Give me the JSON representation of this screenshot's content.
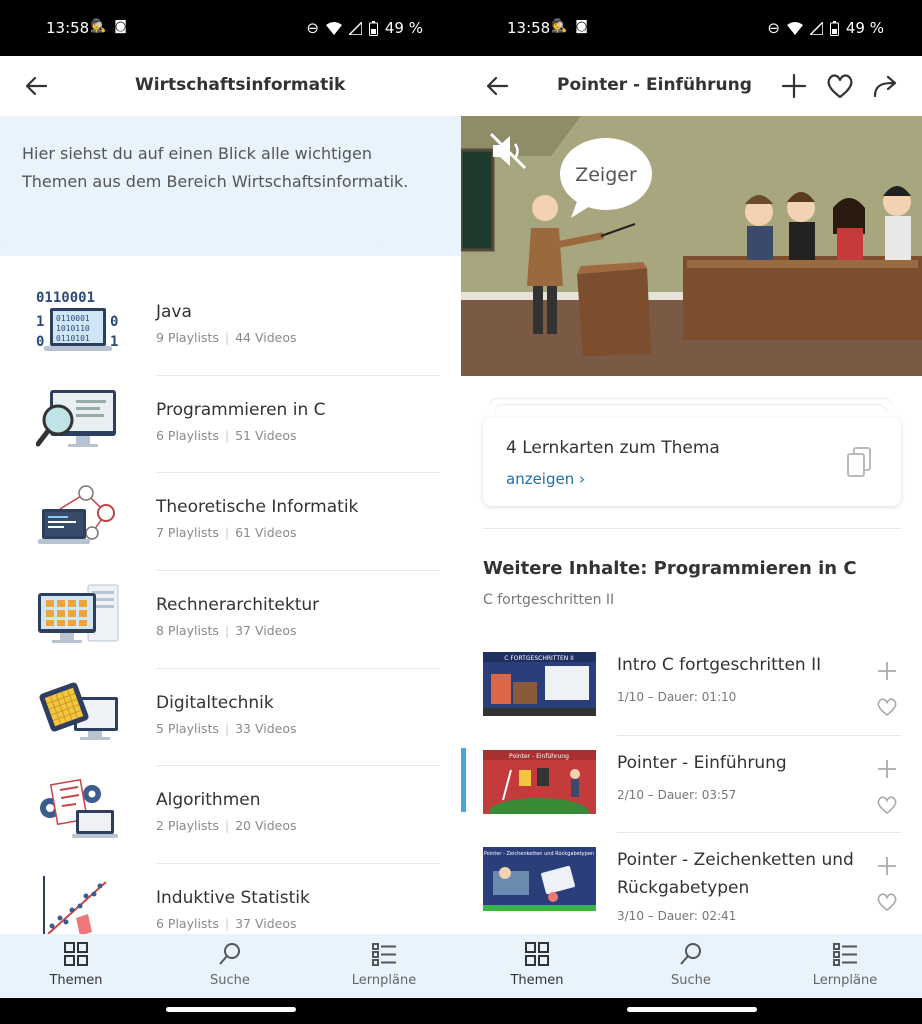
{
  "status": {
    "time": "13:58",
    "battery": "49 %"
  },
  "left": {
    "title": "Wirtschaftsinformatik",
    "intro": "Hier siehst du auf einen Blick alle wichtigen Themen aus dem Bereich Wirtschaftsinformatik.",
    "topics": [
      {
        "name": "Java",
        "playlists": "9 Playlists",
        "videos": "44 Videos",
        "icon": "binary-laptop-icon"
      },
      {
        "name": "Programmieren in C",
        "playlists": "6 Playlists",
        "videos": "51 Videos",
        "icon": "magnifier-monitor-icon"
      },
      {
        "name": "Theoretische Informatik",
        "playlists": "7 Playlists",
        "videos": "61 Videos",
        "icon": "graph-laptop-icon"
      },
      {
        "name": "Rechnerarchitektur",
        "playlists": "8 Playlists",
        "videos": "37 Videos",
        "icon": "computer-tower-icon"
      },
      {
        "name": "Digitaltechnik",
        "playlists": "5 Playlists",
        "videos": "33 Videos",
        "icon": "chip-monitor-icon"
      },
      {
        "name": "Algorithmen",
        "playlists": "2 Playlists",
        "videos": "20 Videos",
        "icon": "gears-laptop-icon"
      },
      {
        "name": "Induktive Statistik",
        "playlists": "6 Playlists",
        "videos": "37 Videos",
        "icon": "scatter-plot-icon"
      }
    ]
  },
  "right": {
    "title": "Pointer - Einführung",
    "video": {
      "bubble": "Zeiger"
    },
    "lernkarten": {
      "title": "4 Lernkarten zum Thema",
      "link": "anzeigen ›"
    },
    "more_heading": "Weitere Inhalte: Programmieren in C",
    "more_sub": "C fortgeschritten II",
    "videos": [
      {
        "title": "Intro C fortgeschritten II",
        "meta": "1/10 – Dauer: 01:10",
        "thumb_caption": "C FORTGESCHRITTEN II"
      },
      {
        "title": "Pointer - Einführung",
        "meta": "2/10 – Dauer: 03:57",
        "thumb_caption": "Pointer - Einführung"
      },
      {
        "title": "Pointer - Zeichenketten und Rückgabetypen",
        "meta": "3/10 – Dauer: 02:41",
        "thumb_caption": "Pointer - Zeichenketten und Rückgabetypen"
      }
    ]
  },
  "nav": {
    "themen": "Themen",
    "suche": "Suche",
    "lernplaene": "Lernpläne"
  },
  "colors": {
    "accent": "#48a6dc",
    "link": "#1f6fa8",
    "nav_bg": "#e8f3fc"
  }
}
